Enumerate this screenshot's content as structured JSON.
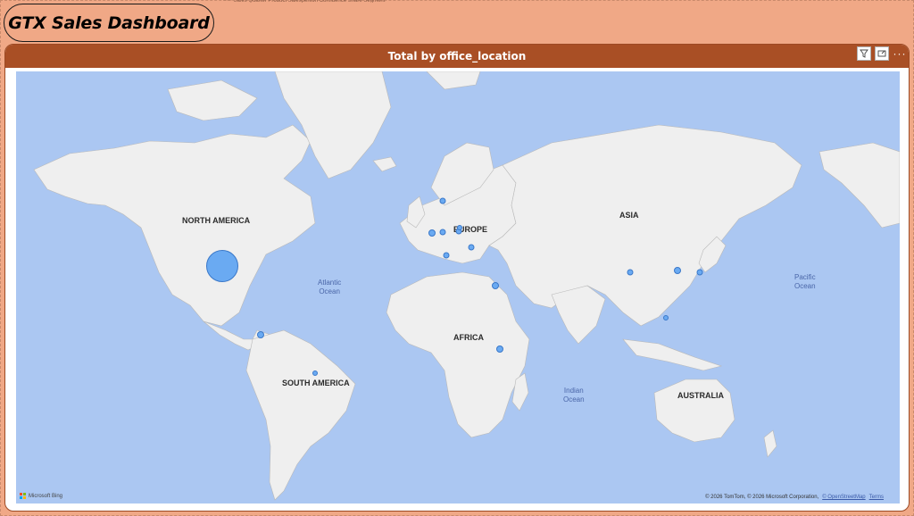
{
  "dashboard": {
    "title": "GTX Sales Dashboard",
    "top_strip_text": "·····  Sales        Quarter        Product        Salesperson       Confidence       Share       Segment"
  },
  "visual": {
    "title": "Total by office_location",
    "toolbar": {
      "filter_icon": "filter-icon",
      "focus_icon": "focus-mode-icon",
      "more_label": "···"
    },
    "map": {
      "regions": [
        {
          "name": "north_america",
          "label": "NORTH AMERICA"
        },
        {
          "name": "europe",
          "label": "EUROPE"
        },
        {
          "name": "asia",
          "label": "ASIA"
        },
        {
          "name": "africa",
          "label": "AFRICA"
        },
        {
          "name": "south_america",
          "label": "SOUTH AMERICA"
        },
        {
          "name": "australia",
          "label": "AUSTRALIA"
        }
      ],
      "oceans": [
        {
          "name": "atlantic",
          "line1": "Atlantic",
          "line2": "Ocean"
        },
        {
          "name": "indian",
          "line1": "Indian",
          "line2": "Ocean"
        },
        {
          "name": "pacific",
          "line1": "Pacific",
          "line2": "Ocean"
        }
      ],
      "locations": [
        {
          "name": "united-states",
          "relative_size": 1.0
        },
        {
          "name": "costa-rica",
          "relative_size": 0.22
        },
        {
          "name": "brazil",
          "relative_size": 0.18
        },
        {
          "name": "norway-sweden",
          "relative_size": 0.22
        },
        {
          "name": "united-kingdom",
          "relative_size": 0.22
        },
        {
          "name": "netherlands",
          "relative_size": 0.2
        },
        {
          "name": "germany",
          "relative_size": 0.2
        },
        {
          "name": "poland",
          "relative_size": 0.2
        },
        {
          "name": "hungary",
          "relative_size": 0.22
        },
        {
          "name": "france-south",
          "relative_size": 0.2
        },
        {
          "name": "egypt",
          "relative_size": 0.22
        },
        {
          "name": "kenya",
          "relative_size": 0.22
        },
        {
          "name": "china",
          "relative_size": 0.2
        },
        {
          "name": "korea",
          "relative_size": 0.22
        },
        {
          "name": "japan",
          "relative_size": 0.22
        },
        {
          "name": "philippines",
          "relative_size": 0.18
        }
      ],
      "bing_label": "Microsoft Bing",
      "attribution": "© 2026 TomTom, © 2026 Microsoft Corporation,",
      "osm_label": "© OpenStreetMap",
      "terms_label": "Terms"
    }
  },
  "colors": {
    "page_background": "#f0a886",
    "header_brown": "#a94f25",
    "ocean": "#abc7f2",
    "land": "#efefef",
    "bubble_fill": "#6aaaf2",
    "bubble_stroke": "#3a78c9"
  }
}
